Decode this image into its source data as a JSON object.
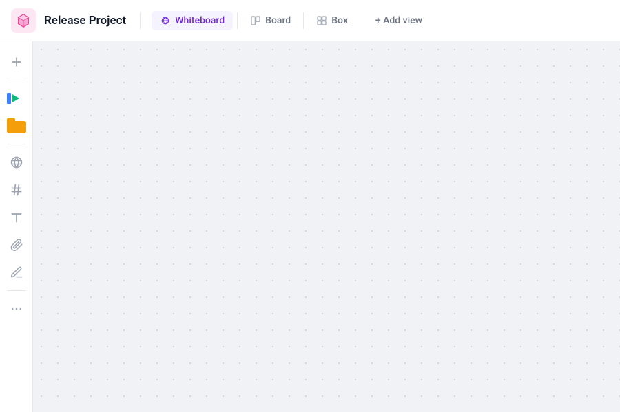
{
  "header": {
    "project_icon_alt": "cube-icon",
    "project_title": "Release Project",
    "tabs": [
      {
        "id": "whiteboard",
        "label": "Whiteboard",
        "active": true,
        "icon": "whiteboard-icon"
      },
      {
        "id": "board",
        "label": "Board",
        "active": false,
        "icon": "board-icon"
      },
      {
        "id": "box",
        "label": "Box",
        "active": false,
        "icon": "box-icon"
      }
    ],
    "add_view_label": "+ Add view"
  },
  "sidebar": {
    "tools": [
      {
        "id": "add",
        "icon": "plus-icon",
        "label": "Add"
      },
      {
        "id": "card-media",
        "icon": "card-media-icon",
        "label": "Card with media"
      },
      {
        "id": "folder",
        "icon": "folder-icon",
        "label": "Folder"
      },
      {
        "id": "globe",
        "icon": "globe-icon",
        "label": "Globe"
      },
      {
        "id": "hash",
        "icon": "hash-icon",
        "label": "Hash"
      },
      {
        "id": "text",
        "icon": "text-icon",
        "label": "Text"
      },
      {
        "id": "attach",
        "icon": "attach-icon",
        "label": "Attach"
      },
      {
        "id": "draw",
        "icon": "draw-icon",
        "label": "Draw"
      },
      {
        "id": "more",
        "icon": "more-icon",
        "label": "More"
      }
    ]
  },
  "canvas": {
    "background_color": "#f0f2f5",
    "dot_color": "#c9ccd0"
  }
}
